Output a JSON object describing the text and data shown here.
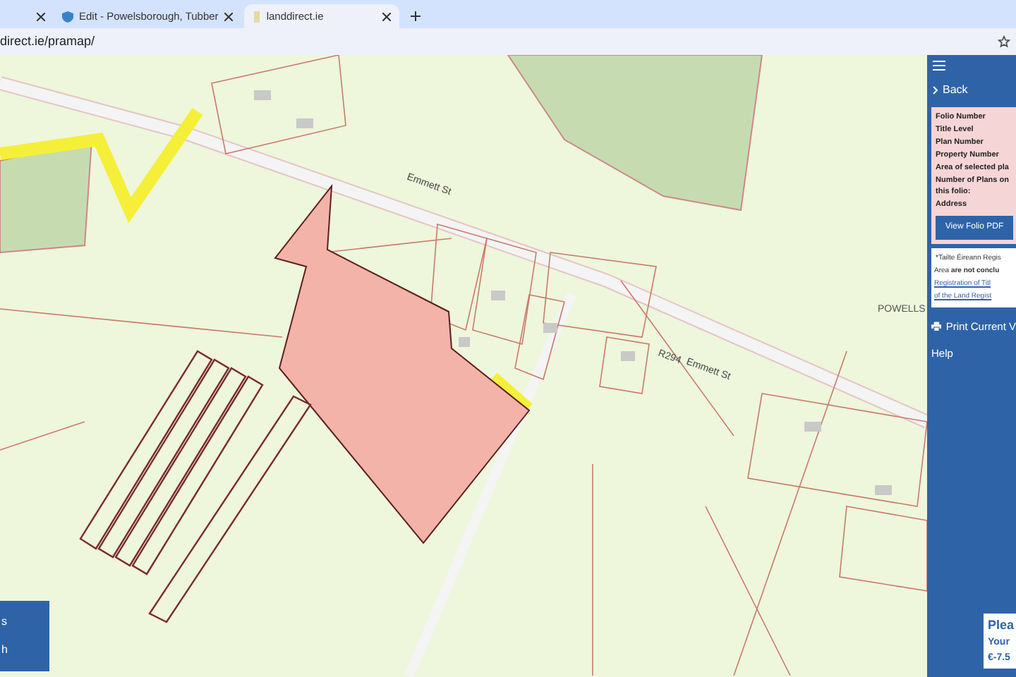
{
  "tabs": [
    {
      "selected": false
    },
    {
      "title": "Edit - Powelsborough, Tubber",
      "selected": false
    },
    {
      "title": "landdirect.ie",
      "selected": true
    }
  ],
  "address_bar": {
    "url": "direct.ie/pramap/"
  },
  "map": {
    "labels": [
      {
        "text": "Emmett St",
        "kind": "street1"
      },
      {
        "text": "R294",
        "kind": "road"
      },
      {
        "text": "Emmett St",
        "kind": "street2"
      },
      {
        "text": "POWELLS",
        "kind": "place"
      }
    ]
  },
  "left_overlay": {
    "lines": [
      "s",
      "h"
    ]
  },
  "panel": {
    "back": "Back",
    "fields": [
      "Folio Number",
      "Title Level",
      "Plan Number",
      "Property Number",
      "Area of selected pla",
      "Number of Plans on this folio:",
      "Address"
    ],
    "pdf_button": "View Folio PDF",
    "notice": {
      "line1": "*Tailte Éireann Regis",
      "line2": "Area **are not conclu**",
      "link1": "Registration of Titl",
      "link2": "of the Land Regist"
    },
    "print": "Print Current V",
    "help": "Help"
  },
  "promo": {
    "lines": [
      "Plea",
      "Your",
      "€-7.5"
    ]
  }
}
